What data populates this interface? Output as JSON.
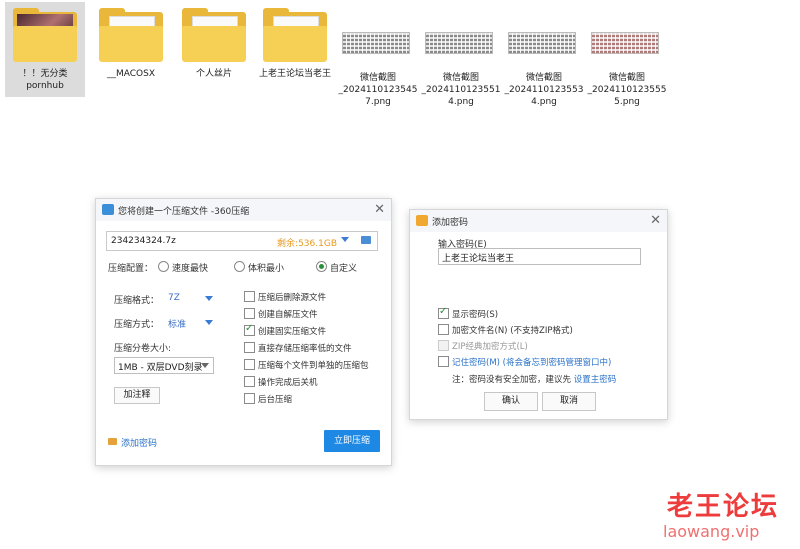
{
  "desktop": {
    "files": [
      {
        "name": "！！无分类\npornhub",
        "kind": "folder-photo",
        "selected": true
      },
      {
        "name": "__MACOSX",
        "kind": "folder"
      },
      {
        "name": "个人丝片",
        "kind": "folder"
      },
      {
        "name": "上老王论坛当老王",
        "kind": "folder"
      },
      {
        "name": "微信截图\n_2024110123545\n7.png",
        "kind": "image"
      },
      {
        "name": "微信截图\n_2024110123551\n4.png",
        "kind": "image"
      },
      {
        "name": "微信截图\n_2024110123553\n4.png",
        "kind": "image"
      },
      {
        "name": "微信截图\n_2024110123555\n5.png",
        "kind": "image"
      }
    ]
  },
  "compress_dialog": {
    "title": "您将创建一个压缩文件 -360压缩",
    "archive_name": "234234324.7z",
    "space_left": "剩余:536.1GB",
    "config_label": "压缩配置：",
    "config_options": [
      "速度最快",
      "体积最小",
      "自定义"
    ],
    "config_selected": "自定义",
    "format_label": "压缩格式：",
    "format_value": "7Z",
    "method_label": "压缩方式：",
    "method_value": "标准",
    "volume_label": "压缩分卷大小:",
    "volume_value": "1MB - 双层DVD刻录",
    "comment_button": "加注释",
    "options": [
      {
        "label": "压缩后删除源文件",
        "checked": false
      },
      {
        "label": "创建自解压文件",
        "checked": false
      },
      {
        "label": "创建固实压缩文件",
        "checked": true
      },
      {
        "label": "直接存储压缩率低的文件",
        "checked": false
      },
      {
        "label": "压缩每个文件到单独的压缩包",
        "checked": false
      },
      {
        "label": "操作完成后关机",
        "checked": false
      },
      {
        "label": "后台压缩",
        "checked": false
      }
    ],
    "add_password": "添加密码",
    "compress_now": "立即压缩"
  },
  "password_dialog": {
    "title": "添加密码",
    "input_label": "输入密码(E)",
    "password_value": "上老王论坛当老王",
    "show_password": "显示密码(S)",
    "encrypt_names": "加密文件名(N) (不支持ZIP格式)",
    "zip_classic": "ZIP经典加密方式(L)",
    "remember_pw": "记住密码(M) (将会备忘到密码管理窗口中)",
    "note_prefix": "注：密码没有安全加密，建议先",
    "note_link": "设置主密码",
    "ok": "确认",
    "cancel": "取消"
  },
  "watermark": {
    "cn": "老王论坛",
    "url": "laowang.vip"
  }
}
